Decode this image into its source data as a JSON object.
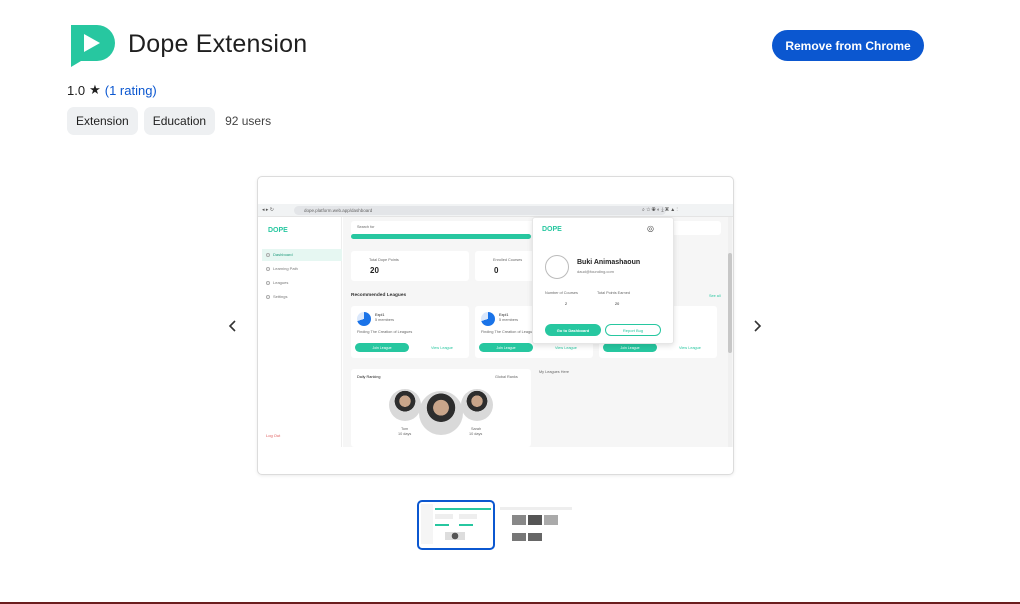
{
  "header": {
    "title": "Dope Extension",
    "remove_label": "Remove from Chrome",
    "rating_value": "1.0",
    "rating_link": "(1 rating)"
  },
  "chips": [
    "Extension",
    "Education"
  ],
  "users": "92 users",
  "colors": {
    "accent": "#0b57d0",
    "brand": "#27c7a0",
    "chip_bg": "#eef0f2"
  },
  "screenshot": {
    "url": "dope.platform.web.app/dashboard",
    "brand": "DOPE",
    "search_placeholder": "Search for",
    "header_user": "Buki Animashaoun",
    "sidebar": [
      "Dashboard",
      "Learning Path",
      "Leagues",
      "Settings"
    ],
    "logout": "Log Out",
    "stats": [
      {
        "label": "Total Dope Points",
        "value": "20"
      },
      {
        "label": "Enrolled Courses",
        "value": "0"
      }
    ],
    "recommended_title": "Recommended Leagues",
    "see_all": "See all",
    "league": {
      "name": "Expl1",
      "sub": "5 members",
      "desc": "Finding The Creation of Leagues",
      "join": "Join League",
      "view": "View League"
    },
    "my_leagues": "My Leagues Here",
    "daily_ranking": "Daily Ranking",
    "global_ranks": "Global Ranks",
    "rankers": [
      {
        "name": "Tom",
        "points": "10 days"
      },
      {
        "name": "Sarah",
        "points": "10 days"
      }
    ],
    "popup": {
      "brand": "DOPE",
      "name": "Buki Animashaoun",
      "email": "daud@founding.com",
      "courses_label": "Number of Courses",
      "courses_value": "2",
      "points_label": "Total Points Earned",
      "points_value": "20",
      "dashboard_btn": "Go to Dashboard",
      "report_btn": "Report Bug"
    }
  }
}
